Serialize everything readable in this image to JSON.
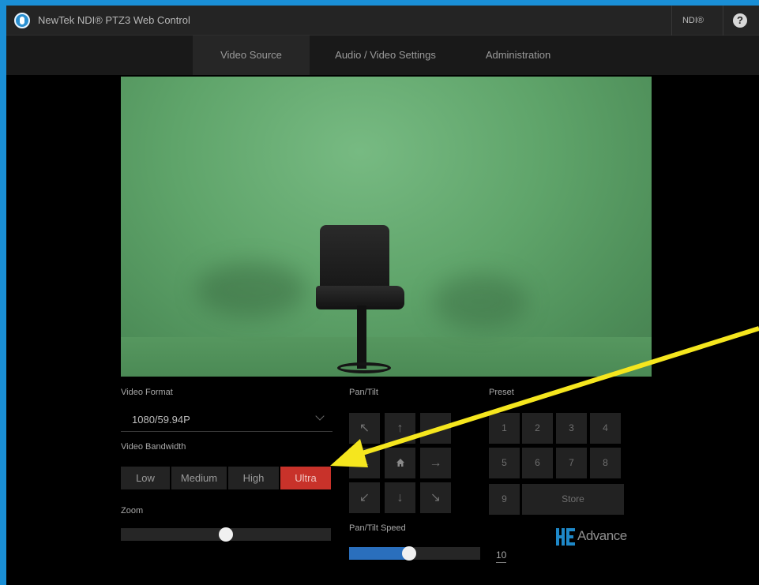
{
  "titlebar": {
    "app_title": "NewTek NDI® PTZ3 Web Control",
    "ndi_label": "NDI®",
    "help_symbol": "?",
    "logo_icon": "newtek-logo-icon"
  },
  "nav": {
    "tabs": [
      {
        "label": "Video Source",
        "active": true
      },
      {
        "label": "Audio / Video Settings",
        "active": false
      },
      {
        "label": "Administration",
        "active": false
      }
    ]
  },
  "video_format": {
    "label": "Video Format",
    "value": "1080/59.94P"
  },
  "video_bandwidth": {
    "label": "Video Bandwidth",
    "options": [
      "Low",
      "Medium",
      "High",
      "Ultra"
    ],
    "selected": "Ultra"
  },
  "zoom": {
    "label": "Zoom",
    "level": 0.5
  },
  "pan_tilt": {
    "label": "Pan/Tilt",
    "buttons": [
      "↖",
      "↑",
      "",
      "←",
      "home-icon",
      "→",
      "↙",
      "↓",
      "↘"
    ],
    "speed_label": "Pan/Tilt Speed",
    "speed_value": "10",
    "speed_level": 0.45
  },
  "preset": {
    "label": "Preset",
    "buttons": [
      "1",
      "2",
      "3",
      "4",
      "5",
      "6",
      "7",
      "8",
      "9"
    ],
    "store_label": "Store"
  },
  "branding": {
    "hevc_text": "Advance",
    "hevc_icon": "hevc-logo-icon"
  },
  "colors": {
    "accent_selected": "#c8322a",
    "slider_fill": "#2a6fbd",
    "border_frame": "#1a8fd6",
    "annotation_arrow": "#f5e61e"
  }
}
